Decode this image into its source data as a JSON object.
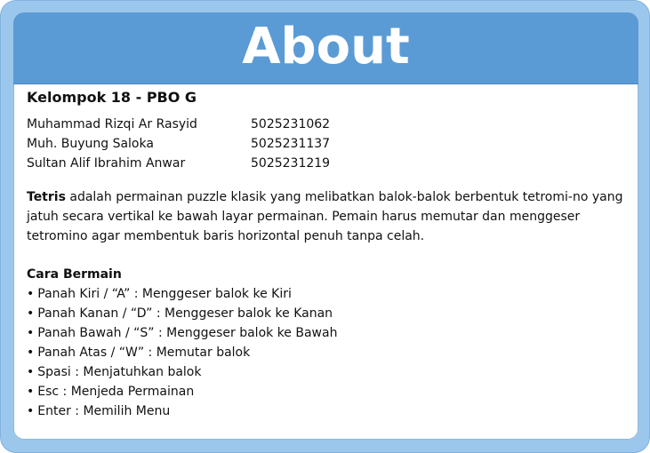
{
  "header": {
    "title": "About"
  },
  "group": {
    "title": "Kelompok 18 - PBO G",
    "members": [
      {
        "name": "Muhammad Rizqi Ar Rasyid",
        "id": "5025231062"
      },
      {
        "name": "Muh. Buyung Saloka",
        "id": "5025231137"
      },
      {
        "name": "Sultan Alif Ibrahim Anwar",
        "id": "5025231219"
      }
    ]
  },
  "description": {
    "strong": "Tetris",
    "text": " adalah permainan puzzle klasik yang melibatkan balok-balok berbentuk tetromi-no yang jatuh secara vertikal ke bawah layar permainan. Pemain harus memutar dan menggeser tetromino agar membentuk baris horizontal penuh tanpa celah."
  },
  "how_to_play": {
    "title": "Cara Bermain",
    "bullet": "•",
    "items": [
      "Panah Kiri / “A” : Menggeser balok ke Kiri",
      "Panah Kanan / “D” : Menggeser balok ke Kanan",
      "Panah Bawah / “S” : Menggeser balok ke Bawah",
      "Panah Atas / “W” : Memutar balok",
      "Spasi : Menjatuhkan balok",
      "Esc : Menjeda Permainan",
      "Enter : Memilih Menu"
    ]
  }
}
